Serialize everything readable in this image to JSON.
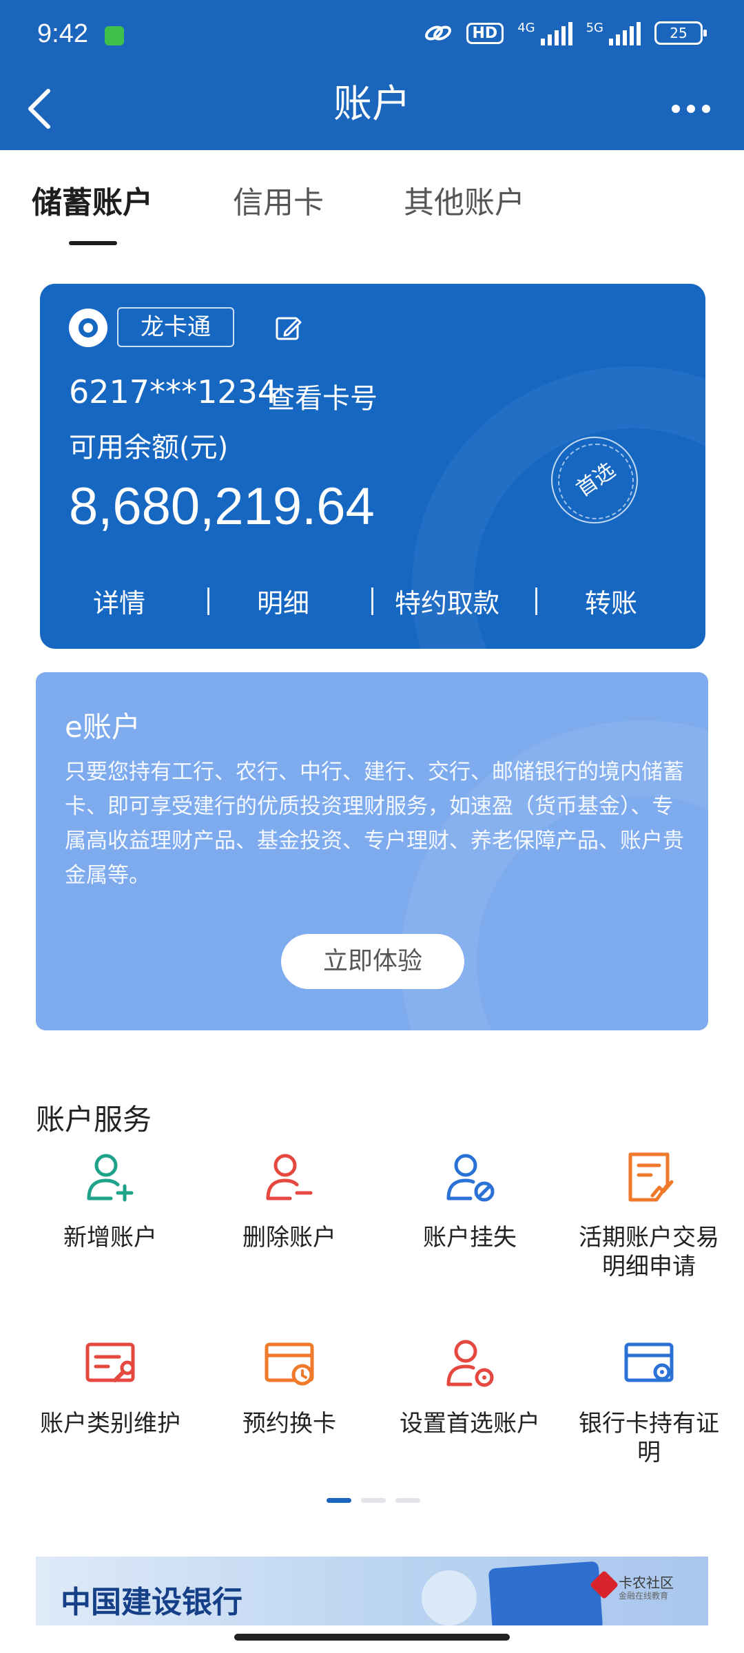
{
  "status_bar": {
    "time": "9:42",
    "hd_label": "HD",
    "net1": "4G",
    "net2": "5G",
    "battery": "25"
  },
  "header": {
    "title": "账户",
    "back_icon": "chevron-left-icon",
    "more_icon": "more-dots-icon"
  },
  "tabs": [
    {
      "label": "储蓄账户",
      "active": true
    },
    {
      "label": "信用卡",
      "active": false
    },
    {
      "label": "其他账户",
      "active": false
    }
  ],
  "card": {
    "name": "龙卡通",
    "number": "6217***1234",
    "view_number": "查看卡号",
    "balance_label": "可用余额(元)",
    "balance": "8,680,219.64",
    "stamp": "首选",
    "actions": [
      "详情",
      "明细",
      "特约取款",
      "转账"
    ]
  },
  "e_account": {
    "title": "e账户",
    "description": "只要您持有工行、农行、中行、建行、交行、邮储银行的境内储蓄卡、即可享受建行的优质投资理财服务，如速盈（货币基金）、专属高收益理财产品、基金投资、专户理财、养老保障产品、账户贵金属等。",
    "button": "立即体验"
  },
  "services": {
    "title": "账户服务",
    "items": [
      {
        "label": "新增账户",
        "icon": "add-user-icon",
        "color": "#1ea38a"
      },
      {
        "label": "删除账户",
        "icon": "remove-user-icon",
        "color": "#e5483f"
      },
      {
        "label": "账户挂失",
        "icon": "block-user-icon",
        "color": "#2a72d6"
      },
      {
        "label": "活期账户交易明细申请",
        "icon": "document-chart-icon",
        "color": "#ef7a2b"
      },
      {
        "label": "账户类别维护",
        "icon": "card-wrench-icon",
        "color": "#e5483f"
      },
      {
        "label": "预约换卡",
        "icon": "card-clock-icon",
        "color": "#ef7a2b"
      },
      {
        "label": "设置首选账户",
        "icon": "user-settings-icon",
        "color": "#e5483f"
      },
      {
        "label": "银行卡持有证明",
        "icon": "card-badge-icon",
        "color": "#2a72d6"
      }
    ]
  },
  "pager": {
    "count": 3,
    "active": 0
  },
  "banner": {
    "text": "中国建设银行",
    "badge_text": "卡农社区",
    "badge_sub": "金融在线教育"
  },
  "colors": {
    "brand": "#1b66bc",
    "card": "#1667c2",
    "e_account_bg": "#7eaaee"
  }
}
